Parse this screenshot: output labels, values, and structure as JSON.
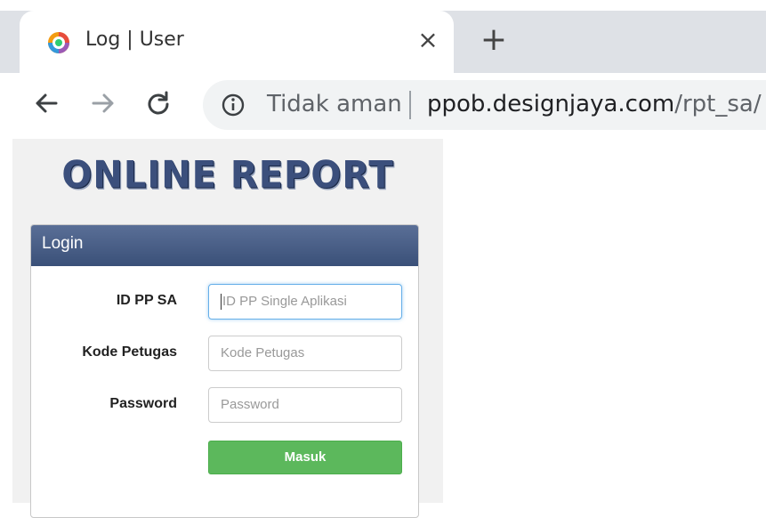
{
  "browser": {
    "tab": {
      "title": "Log | User",
      "favicon": "app-logo-icon",
      "close_glyph": "×"
    },
    "new_tab_glyph": "+",
    "nav": {
      "back_icon": "arrow-left-icon",
      "forward_icon": "arrow-right-icon",
      "reload_icon": "reload-icon"
    },
    "address_bar": {
      "security_icon": "info-icon",
      "security_text": "Tidak aman",
      "url_domain": "ppob.designjaya.com",
      "url_path": "/rpt_sa/"
    }
  },
  "page": {
    "logo_text": "ONLINE REPORT",
    "login_panel": {
      "title": "Login",
      "fields": [
        {
          "label": "ID PP SA",
          "placeholder": "ID PP Single Aplikasi",
          "value": ""
        },
        {
          "label": "Kode Petugas",
          "placeholder": "Kode Petugas",
          "value": ""
        },
        {
          "label": "Password",
          "placeholder": "Password",
          "value": ""
        }
      ],
      "submit_label": "Masuk"
    }
  },
  "colors": {
    "header_blue": "#3a5078",
    "logo_blue": "#3b4f7c",
    "submit_green": "#5cb85c",
    "focus_blue": "#66afe9"
  }
}
